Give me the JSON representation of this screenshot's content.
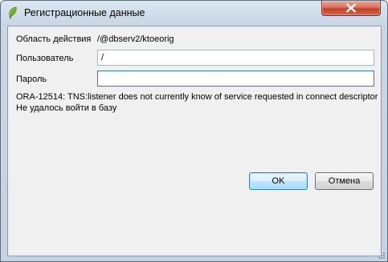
{
  "window": {
    "title": "Регистрационные данные"
  },
  "form": {
    "scope_label": "Область действия",
    "scope_value": "/@dbserv2/ktoeorig",
    "user_label": "Пользователь",
    "user_value": "/",
    "password_label": "Пароль",
    "password_value": ""
  },
  "messages": {
    "error_line": "ORA-12514: TNS:listener does not currently know of service requested in connect descriptor",
    "status_line": "Не удалось войти в базу"
  },
  "buttons": {
    "ok_label": "OK",
    "cancel_label": "Отмена"
  },
  "icons": {
    "app": "qgis-leaf-icon",
    "close": "close-icon",
    "resize": "resize-grip-icon"
  }
}
